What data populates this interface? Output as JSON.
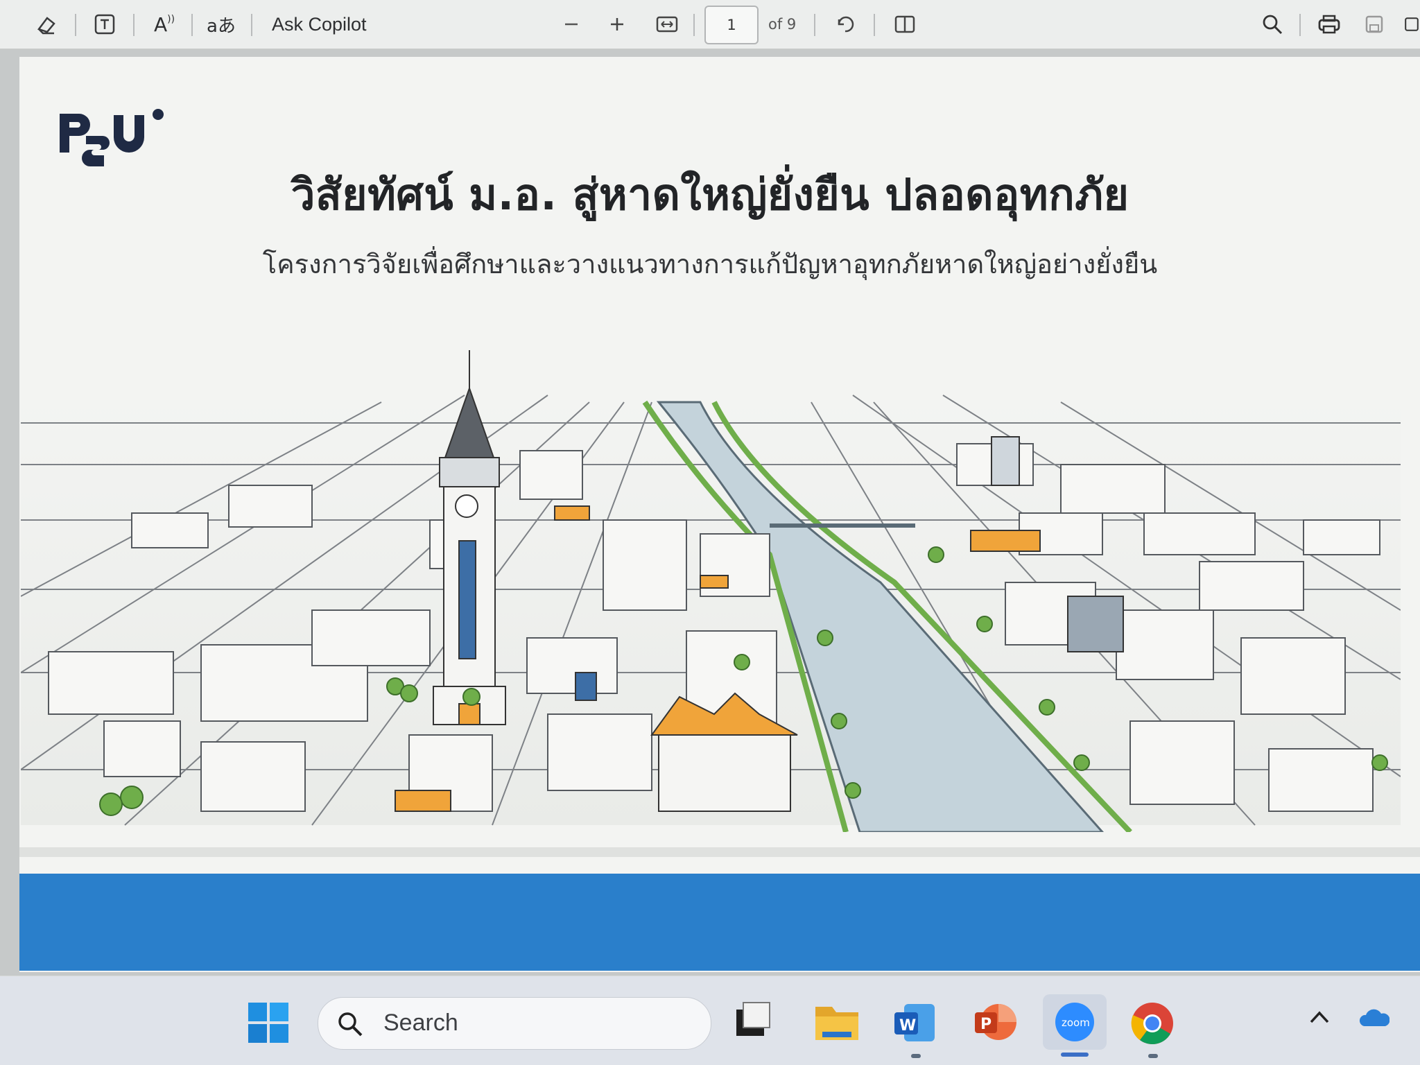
{
  "toolbar": {
    "ask_copilot": "Ask Copilot",
    "page_input": "1",
    "of_pages": "of 9",
    "icons": [
      "eraser-icon",
      "text-box-icon",
      "read-aloud-icon",
      "translate-icon",
      "zoom-out-icon",
      "zoom-in-icon",
      "fit-width-icon",
      "rotate-icon",
      "page-view-icon",
      "search-icon",
      "print-icon",
      "save-icon",
      "save-as-icon"
    ],
    "read_aloud_glyph": "A",
    "translate_glyph": "aあ"
  },
  "document": {
    "logo_text": "PSU",
    "title": "วิสัยทัศน์ ม.อ. สู่หาดใหญ่ยั่งยืน ปลอดอุทกภัย",
    "subtitle": "โครงการวิจัยเพื่อศึกษาและวางแนวทางการแก้ปัญหาอุทกภัยหาดใหญ่อย่างยั่งยืน",
    "illustration": "city-river-illustration",
    "colors": {
      "band": "#2a7fcb",
      "accent_orange": "#f0a43a",
      "river": "#c4d3db",
      "trees": "#6fae4a"
    }
  },
  "taskbar": {
    "search_label": "Search",
    "apps": [
      "start-icon",
      "task-view-icon",
      "file-explorer-icon",
      "word-icon",
      "powerpoint-icon",
      "zoom-icon",
      "chrome-icon"
    ],
    "word_letter": "W",
    "powerpoint_letter": "P",
    "zoom_text": "zoom"
  }
}
